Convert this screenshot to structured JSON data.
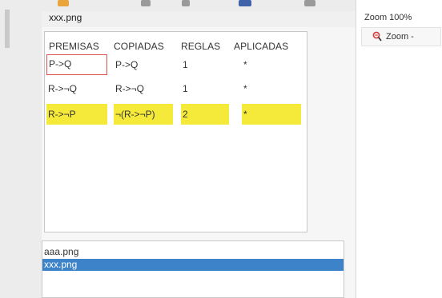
{
  "image_title": "xxx.png",
  "table": {
    "headers": [
      "PREMISAS",
      "COPIADAS",
      "REGLAS",
      "APLICADAS"
    ],
    "rows": [
      {
        "premisa": "P->Q",
        "copiada": "P->Q",
        "regla": "1",
        "aplicada": "*",
        "highlighted": false,
        "premisa_boxed": true
      },
      {
        "premisa": "R->¬Q",
        "copiada": "R->¬Q",
        "regla": "1",
        "aplicada": "*",
        "highlighted": false,
        "premisa_boxed": false
      },
      {
        "premisa": "R->¬P",
        "copiada": "¬(R->¬P)",
        "regla": "2",
        "aplicada": "*",
        "highlighted": true,
        "premisa_boxed": false
      }
    ]
  },
  "file_list": {
    "items": [
      {
        "label": "aaa.png",
        "selected": false
      },
      {
        "label": "xxx.png",
        "selected": true
      }
    ]
  },
  "zoom": {
    "level_text": "Zoom 100%",
    "button_label": "Zoom -",
    "button_icon": "zoom-out-icon"
  },
  "colors": {
    "highlight": "#f5ea3a",
    "selection": "#3c83c9",
    "premise_box_border": "#d9534f"
  }
}
